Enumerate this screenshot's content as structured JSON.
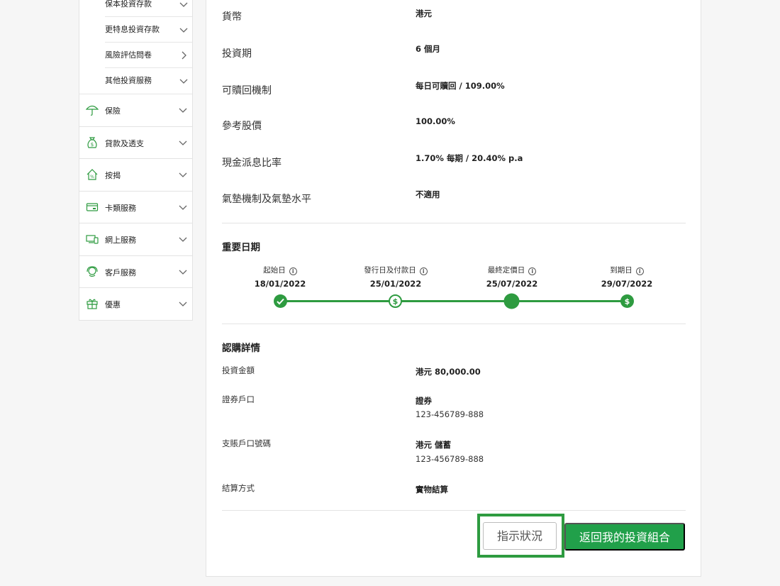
{
  "sidebar": {
    "sub_items": [
      {
        "label": "保本投資存款",
        "chevron": "chevron-down"
      },
      {
        "label": "更特息投資存款",
        "chevron": "chevron-down"
      },
      {
        "label": "風險評估問卷",
        "chevron": "chevron-right"
      },
      {
        "label": "其他投資服務",
        "chevron": "chevron-down"
      }
    ],
    "menu_items": [
      {
        "label": "保險",
        "icon": "umbrella-icon"
      },
      {
        "label": "貸款及透支",
        "icon": "money-bag-icon"
      },
      {
        "label": "按揭",
        "icon": "house-percent-icon"
      },
      {
        "label": "卡類服務",
        "icon": "card-icon"
      },
      {
        "label": "網上服務",
        "icon": "devices-icon"
      },
      {
        "label": "客戶服務",
        "icon": "support-icon"
      },
      {
        "label": "優惠",
        "icon": "gift-icon"
      }
    ]
  },
  "details": [
    {
      "key": "貨幣",
      "value": "港元"
    },
    {
      "key": "投資期",
      "value": "6 個月"
    },
    {
      "key": "可贖回機制",
      "value": "每日可贖回 / 109.00%"
    },
    {
      "key": "參考股價",
      "value": "100.00%"
    },
    {
      "key": "現金派息比率",
      "value": "1.70% 每期 / 20.40% p.a"
    },
    {
      "key": "氣墊機制及氣墊水平",
      "value": "不適用"
    }
  ],
  "important_dates": {
    "title": "重要日期",
    "steps": [
      {
        "label": "起始日",
        "date": "18/01/2022",
        "node": "check"
      },
      {
        "label": "發行日及付款日",
        "date": "25/01/2022",
        "node": "dollar-outline"
      },
      {
        "label": "最終定價日",
        "date": "25/07/2022",
        "node": "current"
      },
      {
        "label": "到期日",
        "date": "29/07/2022",
        "node": "dollar-filled"
      }
    ],
    "info_glyph": "i"
  },
  "subscription": {
    "title": "認購詳情",
    "investment_amount": {
      "key": "投資金額",
      "value": "港元 80,000.00"
    },
    "securities_account": {
      "key": "證券戶口",
      "type": "證券",
      "number": "123-456789-888"
    },
    "settlement_account": {
      "key": "支賬戶口號碼",
      "type": "港元 儲蓄",
      "number": "123-456789-888"
    },
    "settlement_method": {
      "key": "結算方式",
      "value": "實物結算"
    }
  },
  "buttons": {
    "status": "指示狀況",
    "back": "返回我的投資組合"
  },
  "colors": {
    "accent": "#2e9b40",
    "button": "#21a04a"
  }
}
